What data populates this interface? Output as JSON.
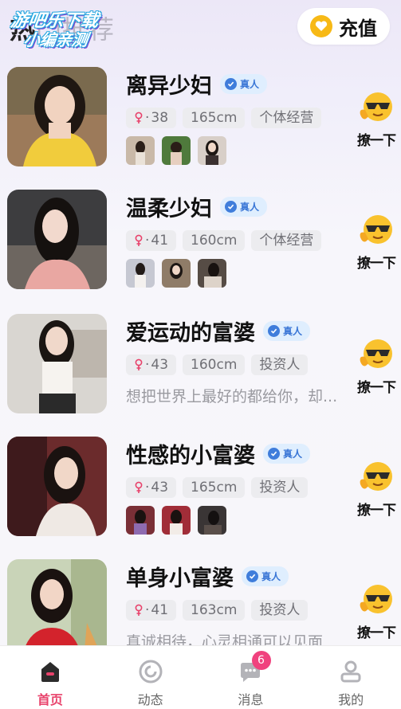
{
  "header": {
    "title_first": "热",
    "title_rest": "门推荐",
    "watermark_line1": "游吧乐下载",
    "watermark_line2": "小编亲测",
    "recharge_label": "充值",
    "recharge_icon": "heart-coin-icon"
  },
  "verified_label": "真人",
  "flirt_label": "撩一下",
  "flirt_icon": "cool-emoji-icon",
  "profiles": [
    {
      "name": "离异少妇",
      "age": "38",
      "height": "165cm",
      "job": "个体经营",
      "bio": "",
      "thumbs": 3
    },
    {
      "name": "温柔少妇",
      "age": "41",
      "height": "160cm",
      "job": "个体经营",
      "bio": "",
      "thumbs": 3
    },
    {
      "name": "爱运动的富婆",
      "age": "43",
      "height": "160cm",
      "job": "投资人",
      "bio": "想把世界上最好的都给你，却...",
      "thumbs": 0
    },
    {
      "name": "性感的小富婆",
      "age": "43",
      "height": "165cm",
      "job": "投资人",
      "bio": "",
      "thumbs": 3
    },
    {
      "name": "单身小富婆",
      "age": "41",
      "height": "163cm",
      "job": "投资人",
      "bio": "真诚相待，心灵相通可以见面",
      "thumbs": 0
    }
  ],
  "tabbar": {
    "tabs": [
      {
        "label": "首页",
        "icon": "home-icon"
      },
      {
        "label": "动态",
        "icon": "moments-icon"
      },
      {
        "label": "消息",
        "icon": "message-icon",
        "badge": "6"
      },
      {
        "label": "我的",
        "icon": "profile-icon"
      }
    ]
  },
  "colors": {
    "accent": "#e8426b",
    "badge": "#f0427e",
    "verified": "#3f7ddb",
    "coin": "#f7b916"
  }
}
